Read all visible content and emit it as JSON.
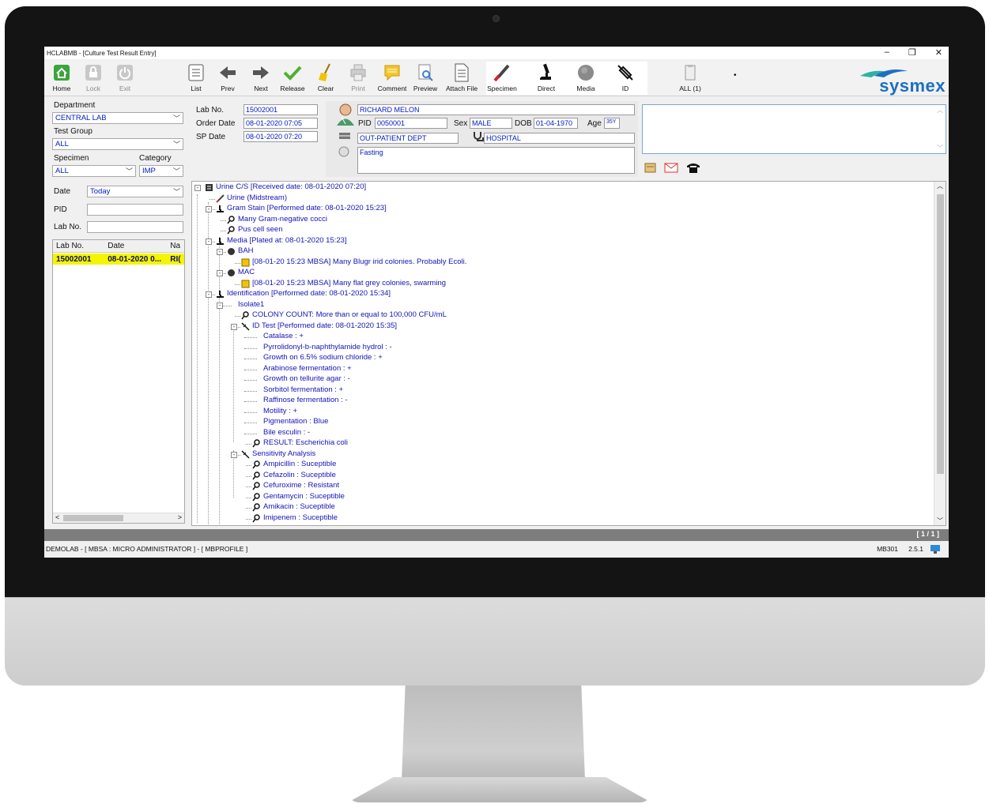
{
  "window": {
    "title": "HCLABMB - [Culture Test Result Entry]"
  },
  "toolbar": {
    "home": "Home",
    "lock": "Lock",
    "exit": "Exit",
    "list": "List",
    "prev": "Prev",
    "next": "Next",
    "release": "Release",
    "clear": "Clear",
    "print": "Print",
    "comment": "Comment",
    "preview": "Preview",
    "attach": "Attach File",
    "specimen": "Specimen",
    "direct": "Direct",
    "media": "Media",
    "id": "ID",
    "all": "ALL (1)",
    "dot": "•"
  },
  "brand": {
    "name": "sysmex",
    "color": "#1c6fc0"
  },
  "filters": {
    "department_label": "Department",
    "department": "CENTRAL LAB",
    "testgroup_label": "Test Group",
    "testgroup": "ALL",
    "specimen_label": "Specimen",
    "specimen": "ALL",
    "category_label": "Category",
    "category": "IMP",
    "date_label": "Date",
    "date": "Today",
    "pid_label": "PID",
    "pid": "",
    "labno_label": "Lab No.",
    "labno": ""
  },
  "grid": {
    "columns": [
      "Lab No.",
      "Date",
      "Na"
    ],
    "rows": [
      [
        "15002001",
        "08-01-2020 0...",
        "RI("
      ]
    ]
  },
  "order": {
    "labno_label": "Lab No.",
    "labno": "15002001",
    "orderdate_label": "Order Date",
    "orderdate": "08-01-2020 07:05",
    "spdate_label": "SP Date",
    "spdate": "08-01-2020 07:20"
  },
  "patient": {
    "name": "RICHARD MELON",
    "pid_label": "PID",
    "pid": "0050001",
    "sex_label": "Sex",
    "sex": "MALE",
    "dob_label": "DOB",
    "dob": "01-04-1970",
    "age_label": "Age",
    "age": "35Y",
    "dept": "OUT-PATIENT DEPT",
    "hospital": "HOSPITAL",
    "note": "Fasting"
  },
  "tree": [
    {
      "t": "Urine C/S  [Received date: 08-01-2020 07:20]"
    },
    {
      "t": "Urine (Midstream)"
    },
    {
      "t": "Gram Stain  [Performed date: 08-01-2020 15:23]"
    },
    {
      "t": "Many Gram-negative cocci"
    },
    {
      "t": "Pus cell seen"
    },
    {
      "t": "Media  [Plated at: 08-01-2020 15:23]"
    },
    {
      "t": "BAH"
    },
    {
      "t": "[08-01-20 15:23 MBSA] Many Blugr irid colonies. Probably Ecoli."
    },
    {
      "t": "MAC"
    },
    {
      "t": "[08-01-20 15:23 MBSA] Many flat grey colonies, swarming"
    },
    {
      "t": "Identification  [Performed date: 08-01-2020 15:34]"
    },
    {
      "t": "Isolate1"
    },
    {
      "t": "COLONY COUNT: More than or equal to 100,000 CFU/mL"
    },
    {
      "t": "ID Test  [Performed date: 08-01-2020 15:35]"
    },
    {
      "t": "Catalase : +"
    },
    {
      "t": "Pyrrolidonyl-b-naphthylamide hydrol : -"
    },
    {
      "t": "Growth on 6.5% sodium chloride  : +"
    },
    {
      "t": "Arabinose fermentation : +"
    },
    {
      "t": "Growth on tellurite agar : -"
    },
    {
      "t": "Sorbitol fermentation : +"
    },
    {
      "t": "Raffinose fermentation : -"
    },
    {
      "t": "Motility : +"
    },
    {
      "t": "Pigmentation : Blue"
    },
    {
      "t": "Bile esculin : -"
    },
    {
      "t": "RESULT: Escherichia coli"
    },
    {
      "t": "Sensitivity Analysis"
    },
    {
      "t": "Ampicillin : Suceptible"
    },
    {
      "t": "Cefazolin : Suceptible"
    },
    {
      "t": "Cefuroxime : Resistant"
    },
    {
      "t": "Gentamycin : Suceptible"
    },
    {
      "t": "Amikacin : Suceptible"
    },
    {
      "t": "Imipenem : Suceptible"
    }
  ],
  "pager": "[ 1 / 1 ]",
  "status": {
    "left": "DEMOLAB - [ MBSA : MICRO ADMINISTRATOR ] - [ MBPROFILE ]",
    "code": "MB301",
    "version": "2.5.1"
  }
}
